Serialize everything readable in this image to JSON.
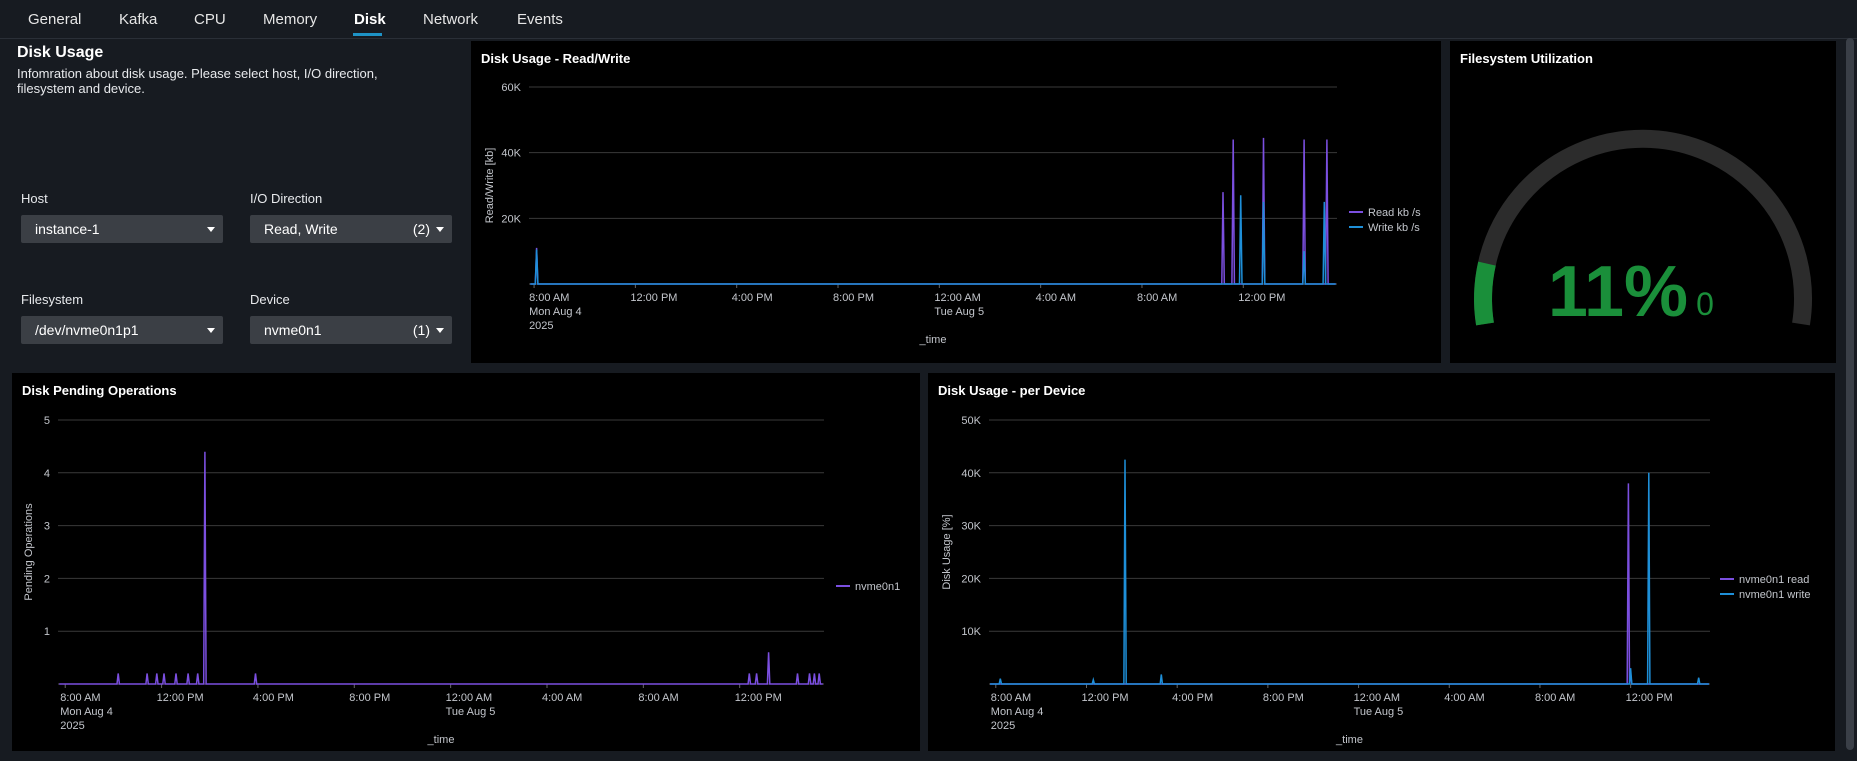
{
  "tabs": [
    {
      "label": "General"
    },
    {
      "label": "Kafka"
    },
    {
      "label": "CPU"
    },
    {
      "label": "Memory"
    },
    {
      "label": "Disk"
    },
    {
      "label": "Network"
    },
    {
      "label": "Events"
    }
  ],
  "active_tab": "Disk",
  "intro": {
    "title": "Disk Usage",
    "description": "Infomration about disk usage. Please select host, I/O direction, filesystem and device."
  },
  "filters": {
    "host": {
      "label": "Host",
      "value": "instance-1"
    },
    "io_direction": {
      "label": "I/O Direction",
      "value": "Read, Write",
      "count": "(2)"
    },
    "filesystem": {
      "label": "Filesystem",
      "value": "/dev/nvme0n1p1"
    },
    "device": {
      "label": "Device",
      "value": "nvme0n1",
      "count": "(1)"
    }
  },
  "gauge": {
    "title": "Filesystem Utilization",
    "value_text": "11%",
    "secondary_text": "0",
    "fraction": 0.11,
    "color": "#1a8f3a",
    "track_color": "#2c2c2c"
  },
  "colors": {
    "purple": "#7b4fe0",
    "blue": "#1e8fd8"
  },
  "time_ticks": [
    {
      "lines": [
        "8:00 AM",
        "Mon Aug 4",
        "2025"
      ]
    },
    {
      "lines": [
        "12:00 PM"
      ]
    },
    {
      "lines": [
        "4:00 PM"
      ]
    },
    {
      "lines": [
        "8:00 PM"
      ]
    },
    {
      "lines": [
        "12:00 AM",
        "Tue Aug 5"
      ]
    },
    {
      "lines": [
        "4:00 AM"
      ]
    },
    {
      "lines": [
        "8:00 AM"
      ]
    },
    {
      "lines": [
        "12:00 PM"
      ]
    }
  ],
  "chart_data": [
    {
      "type": "line",
      "title": "Disk Usage - Read/Write",
      "xlabel": "_time",
      "ylabel": "Read/Write [kb]",
      "ylim": [
        0,
        60000
      ],
      "yticks": [
        "20K",
        "40K",
        "60K"
      ],
      "legend_position": "right",
      "x_range_hours": [
        -0.2,
        31.7
      ],
      "series": [
        {
          "name": "Read kb /s",
          "color": "#7b4fe0",
          "peaks": [
            [
              0.1,
              11000
            ],
            [
              27.2,
              28000
            ],
            [
              27.6,
              44000
            ],
            [
              28.8,
              44500
            ],
            [
              30.4,
              44000
            ],
            [
              31.3,
              44000
            ]
          ]
        },
        {
          "name": "Write kb /s",
          "color": "#1e8fd8",
          "peaks": [
            [
              0.1,
              10500
            ],
            [
              27.9,
              27000
            ],
            [
              28.8,
              25000
            ],
            [
              30.4,
              10000
            ],
            [
              31.2,
              25000
            ]
          ]
        }
      ]
    },
    {
      "type": "line",
      "title": "Disk Pending Operations",
      "xlabel": "_time",
      "ylabel": "Pending Operations",
      "ylim": [
        0,
        5
      ],
      "yticks": [
        "1",
        "2",
        "3",
        "4",
        "5"
      ],
      "legend_position": "right",
      "x_range_hours": [
        -0.3,
        31.5
      ],
      "series": [
        {
          "name": "nvme0n1",
          "color": "#7b4fe0",
          "peaks": [
            [
              2.2,
              0.2
            ],
            [
              3.4,
              0.2
            ],
            [
              3.8,
              0.2
            ],
            [
              4.1,
              0.2
            ],
            [
              4.6,
              0.2
            ],
            [
              5.1,
              0.2
            ],
            [
              5.5,
              0.2
            ],
            [
              5.8,
              4.4
            ],
            [
              7.9,
              0.2
            ],
            [
              28.4,
              0.2
            ],
            [
              28.7,
              0.2
            ],
            [
              29.2,
              0.6
            ],
            [
              30.4,
              0.2
            ],
            [
              30.9,
              0.2
            ],
            [
              31.1,
              0.2
            ],
            [
              31.3,
              0.2
            ]
          ]
        }
      ]
    },
    {
      "type": "line",
      "title": "Disk Usage - per Device",
      "xlabel": "_time",
      "ylabel": "Disk Usage [%]",
      "ylim": [
        0,
        50000
      ],
      "yticks": [
        "10K",
        "20K",
        "30K",
        "40K",
        "50K"
      ],
      "legend_position": "right",
      "x_range_hours": [
        -0.3,
        31.5
      ],
      "series": [
        {
          "name": "nvme0n1 read",
          "color": "#7b4fe0",
          "peaks": [
            [
              27.9,
              38000
            ],
            [
              28.0,
              2000
            ]
          ]
        },
        {
          "name": "nvme0n1 write",
          "color": "#1e8fd8",
          "peaks": [
            [
              0.2,
              1000
            ],
            [
              4.3,
              800
            ],
            [
              5.7,
              42500
            ],
            [
              7.3,
              1800
            ],
            [
              28.0,
              3000
            ],
            [
              28.8,
              40000
            ],
            [
              31.0,
              1200
            ]
          ]
        }
      ]
    }
  ]
}
